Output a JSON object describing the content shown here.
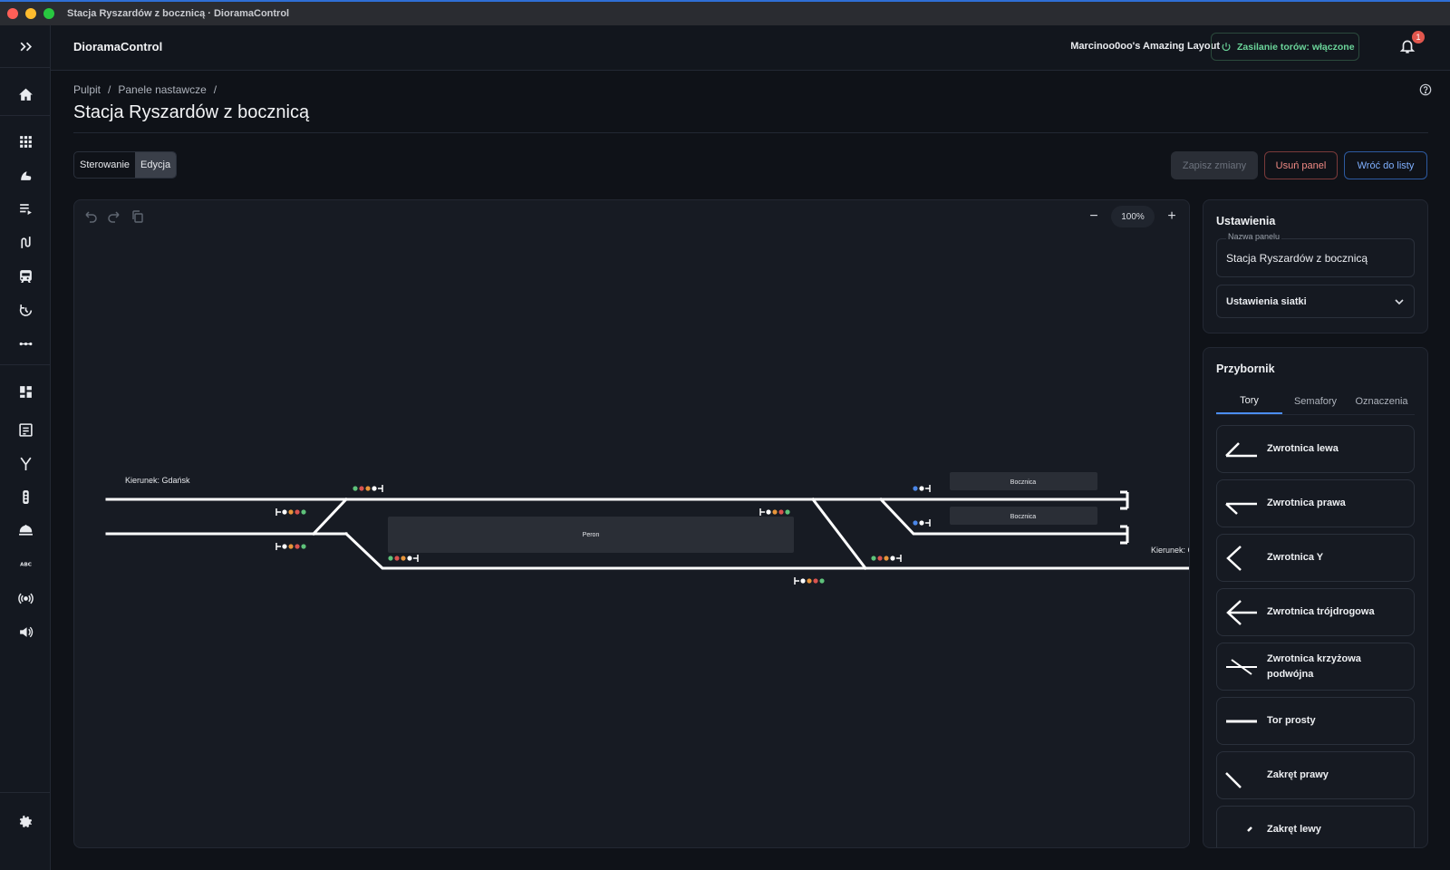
{
  "window": {
    "title": "Stacja Ryszardów z bocznicą · DioramaControl"
  },
  "app": {
    "name": "DioramaControl",
    "layout_name": "Marcinoo0oo's Amazing Layout",
    "power_status": "Zasilanie torów: włączone",
    "notifications_count": "1"
  },
  "rail": {
    "icons": [
      "expand-icon",
      "home-icon",
      "grid-icon",
      "locomotive-icon",
      "playlist-icon",
      "routes-icon",
      "train-icon",
      "automation-icon",
      "more-icon",
      "dashboard-icon",
      "panels-icon",
      "switch-icon",
      "signal-icon",
      "turntable-icon",
      "abc-icon",
      "broadcast-icon",
      "sound-icon",
      "settings-icon"
    ]
  },
  "breadcrumb": {
    "items": [
      "Pulpit",
      "/",
      "Panele nastawcze",
      "/"
    ]
  },
  "page": {
    "title": "Stacja Ryszardów z bocznicą"
  },
  "modes": {
    "control": "Sterowanie",
    "edit": "Edycja",
    "active": "edit"
  },
  "actions": {
    "save": "Zapisz zmiany",
    "delete": "Usuń panel",
    "back": "Wróć do listy"
  },
  "canvas": {
    "zoom": "100%",
    "labels": {
      "direction_left": "Kierunek: Gdańsk",
      "direction_right": "Kierunek: C",
      "platform": "Peron",
      "siding_1": "Bocznica",
      "siding_2": "Bocznica"
    },
    "colors": {
      "track": "#ffffff",
      "background": "#171b23",
      "signal_green": "#5ec27a",
      "signal_red": "#d9534f",
      "signal_orange": "#e8953a",
      "signal_blue": "#4a86e8"
    }
  },
  "settings": {
    "title": "Ustawienia",
    "panel_name_label": "Nazwa panelu",
    "panel_name_value": "Stacja Ryszardów z bocznicą",
    "grid_settings": "Ustawienia siatki"
  },
  "toolbox": {
    "title": "Przybornik",
    "tabs": [
      "Tory",
      "Semafory",
      "Oznaczenia"
    ],
    "active_tab": "Tory",
    "items": [
      {
        "label": "Zwrotnica lewa",
        "icon": "switch-left-icon"
      },
      {
        "label": "Zwrotnica prawa",
        "icon": "switch-right-icon"
      },
      {
        "label": "Zwrotnica Y",
        "icon": "switch-y-icon"
      },
      {
        "label": "Zwrotnica trójdrogowa",
        "icon": "switch-three-way-icon"
      },
      {
        "label": "Zwrotnica krzyżowa podwójna",
        "icon": "double-slip-icon"
      },
      {
        "label": "Tor prosty",
        "icon": "straight-track-icon"
      },
      {
        "label": "Zakręt prawy",
        "icon": "curve-right-icon"
      },
      {
        "label": "Zakręt lewy",
        "icon": "curve-left-icon"
      }
    ]
  }
}
